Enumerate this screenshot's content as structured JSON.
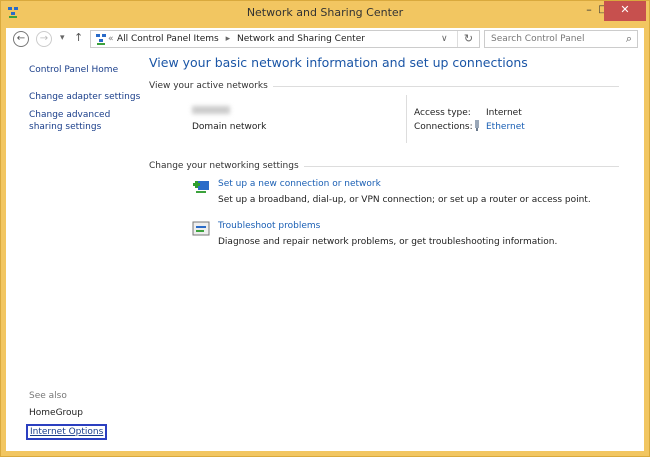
{
  "window": {
    "title": "Network and Sharing Center",
    "minimize": "–",
    "maximize": "□",
    "close": "✕"
  },
  "nav": {
    "back": "←",
    "forward": "→",
    "recent": "▾",
    "up": "↑",
    "breadcrumb_sep": "«",
    "crumbs": [
      "All Control Panel Items",
      "Network and Sharing Center"
    ],
    "crumb_arrow": "▸",
    "dropdown": "∨",
    "refresh": "↻",
    "search_placeholder": "Search Control Panel",
    "search_icon": "⌕"
  },
  "sidebar": {
    "items": [
      "Control Panel Home",
      "Change adapter settings",
      "Change advanced sharing settings"
    ],
    "see_also": "See also",
    "see_also_items": [
      "HomeGroup",
      "Internet Options"
    ]
  },
  "main": {
    "heading": "View your basic network information and set up connections",
    "active_label": "View your active networks",
    "network_type": "Domain network",
    "access_type_label": "Access type:",
    "access_type": "Internet",
    "connections_label": "Connections:",
    "connection": "Ethernet",
    "change_label": "Change your networking settings",
    "tasks": [
      {
        "title": "Set up a new connection or network",
        "desc": "Set up a broadband, dial-up, or VPN connection; or set up a router or access point.",
        "icon": "new-connection-icon"
      },
      {
        "title": "Troubleshoot problems",
        "desc": "Diagnose and repair network problems, or get troubleshooting information.",
        "icon": "troubleshoot-icon"
      }
    ]
  },
  "colors": {
    "frame": "#f2c661",
    "link": "#1a5fb4",
    "close": "#c7504e",
    "highlight": "#2b3fc0"
  }
}
